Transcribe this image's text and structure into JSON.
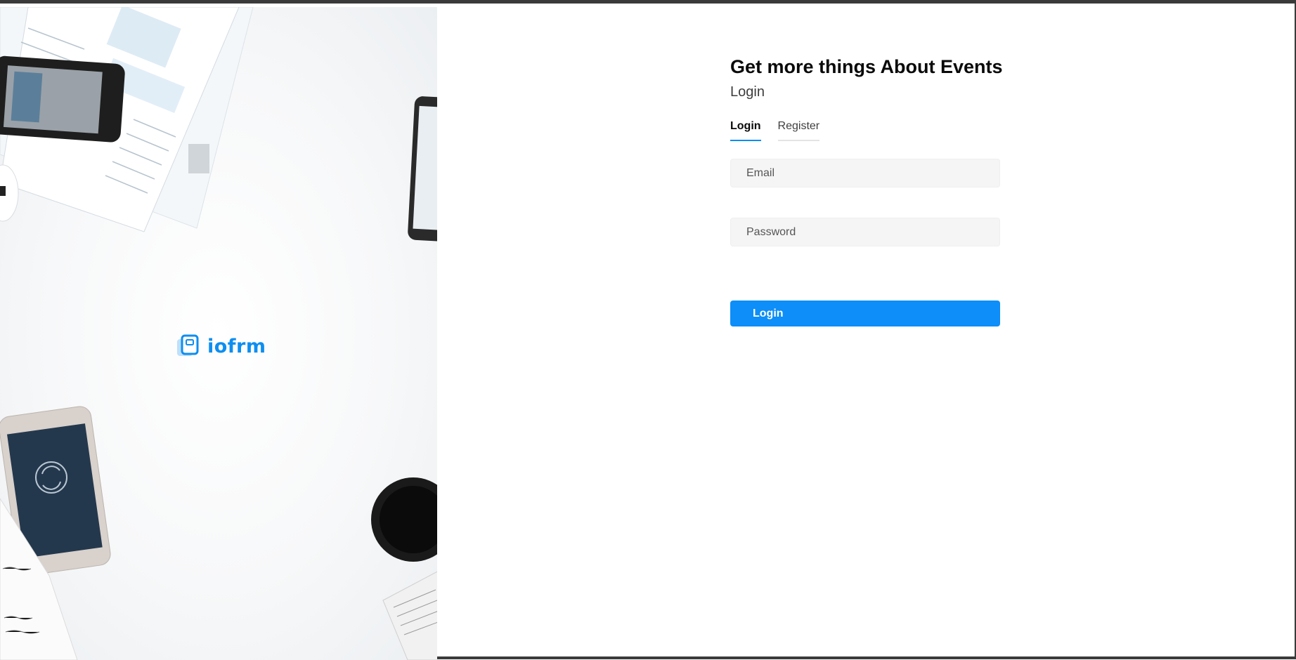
{
  "brand": {
    "name": "iofrm",
    "logo_icon": "iofrm-logo-icon"
  },
  "form": {
    "title": "Get more things About Events",
    "subtitle": "Login",
    "tabs": [
      {
        "label": "Login",
        "active": true
      },
      {
        "label": "Register",
        "active": false
      }
    ],
    "email_placeholder": "Email",
    "password_placeholder": "Password",
    "submit_label": "Login"
  },
  "colors": {
    "accent": "#0d8ef8",
    "brand": "#0d8ef0",
    "input_bg": "#f5f5f5",
    "title": "#0a0a0a"
  }
}
